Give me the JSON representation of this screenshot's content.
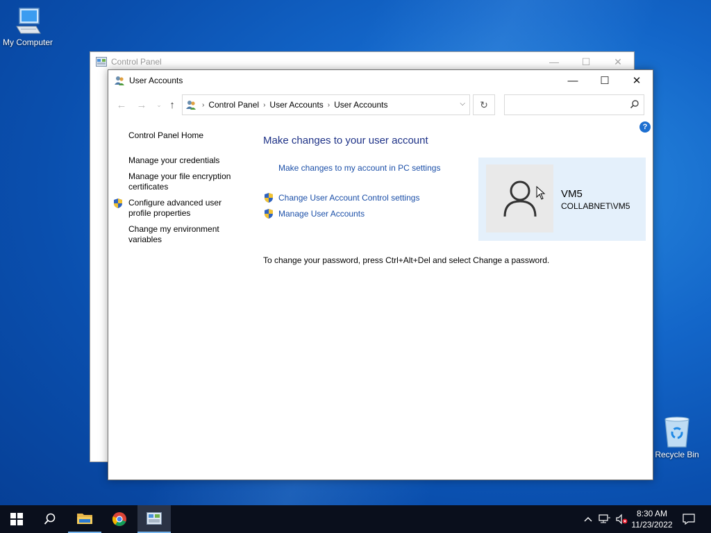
{
  "desktop": {
    "icons": [
      {
        "label": "My Computer"
      },
      {
        "label": "Recycle Bin"
      }
    ]
  },
  "background_window": {
    "title": "Control Panel"
  },
  "window": {
    "title": "User Accounts",
    "controls": {
      "minimize": "—",
      "maximize": "☐",
      "close": "✕"
    }
  },
  "address_bar": {
    "crumbs": [
      "Control Panel",
      "User Accounts",
      "User Accounts"
    ],
    "separator": "›",
    "search_placeholder": ""
  },
  "left_pane": {
    "home": "Control Panel Home",
    "links": [
      "Manage your credentials",
      "Manage your file encryption certificates",
      "Configure advanced user profile properties",
      "Change my environment variables"
    ]
  },
  "main": {
    "heading": "Make changes to your user account",
    "pc_settings_link": "Make changes to my account in PC settings",
    "uac_link": "Change User Account Control settings",
    "manage_link": "Manage User Accounts",
    "password_info": "To change your password, press Ctrl+Alt+Del and select Change a password."
  },
  "user_tile": {
    "name": "VM5",
    "domain": "COLLABNET\\VM5"
  },
  "taskbar": {
    "time": "8:30 AM",
    "date": "11/23/2022"
  },
  "colors": {
    "accent_link": "#1b4fa8",
    "heading": "#1e3287",
    "taskbar": "#0a0f1c",
    "user_tile": "#e4f0fb"
  }
}
